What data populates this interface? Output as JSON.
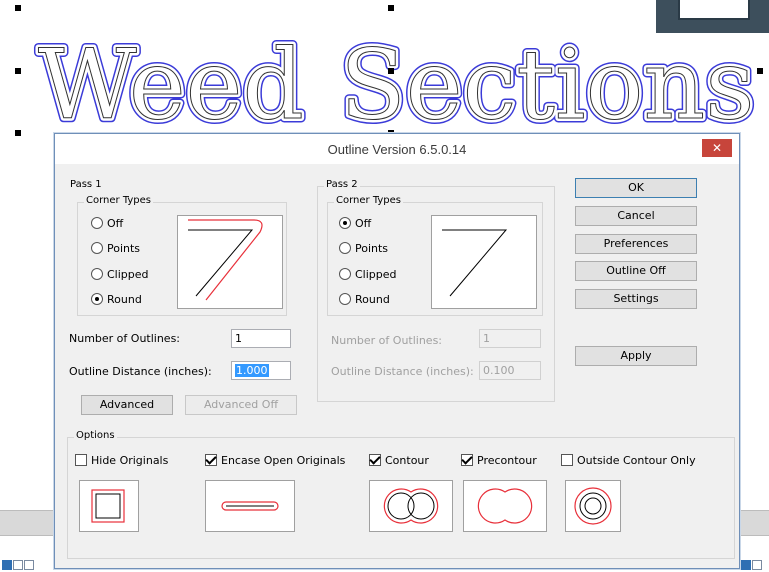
{
  "background_art": {
    "text_left": "Weed",
    "text_right": "Sections",
    "outline_color": "#3b3bd8"
  },
  "dialog": {
    "title": "Outline Version 6.5.0.14",
    "close_glyph": "✕",
    "pass1": {
      "legend": "Pass 1",
      "corner_types_legend": "Corner Types",
      "options": [
        "Off",
        "Points",
        "Clipped",
        "Round"
      ],
      "selected": "Round",
      "number_label": "Number of Outlines:",
      "number_value": "1",
      "distance_label": "Outline Distance (inches):",
      "distance_value": "1.000",
      "advanced_label": "Advanced",
      "advanced_off_label": "Advanced Off"
    },
    "pass2": {
      "legend": "Pass 2",
      "corner_types_legend": "Corner Types",
      "options": [
        "Off",
        "Points",
        "Clipped",
        "Round"
      ],
      "selected": "Off",
      "number_label": "Number of Outlines:",
      "number_value": "1",
      "distance_label": "Outline Distance (inches):",
      "distance_value": "0.100"
    },
    "buttons": {
      "ok": "OK",
      "cancel": "Cancel",
      "preferences": "Preferences",
      "outline_off": "Outline Off",
      "settings": "Settings",
      "apply": "Apply"
    },
    "options": {
      "legend": "Options",
      "hide_originals": {
        "label": "Hide Originals",
        "checked": false
      },
      "encase_open": {
        "label": "Encase Open Originals",
        "checked": true
      },
      "contour": {
        "label": "Contour",
        "checked": true
      },
      "precontour": {
        "label": "Precontour",
        "checked": true
      },
      "outside_only": {
        "label": "Outside Contour Only",
        "checked": false
      }
    },
    "colors": {
      "close_bg": "#c7453b",
      "outline_red": "#e8303a",
      "selection_blue": "#3399ff"
    }
  }
}
